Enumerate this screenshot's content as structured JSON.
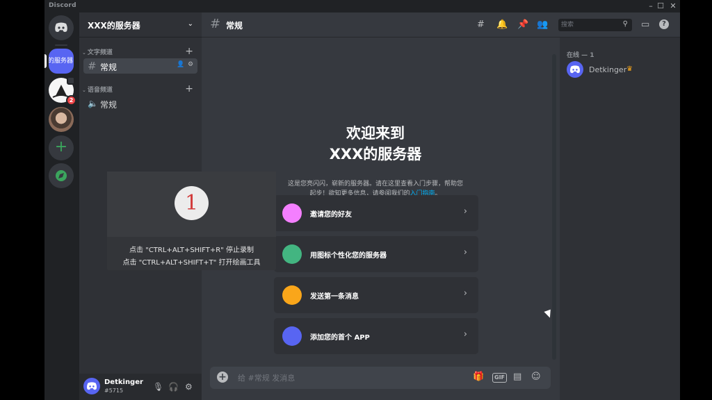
{
  "window": {
    "app_name": "Discord",
    "controls": {
      "minimize": "–",
      "maximize": "☐",
      "close": "✕"
    }
  },
  "rail": {
    "active_server_label": "的服务器",
    "server2_badge": "2"
  },
  "server": {
    "name": "XXX的服务器"
  },
  "categories": [
    {
      "label": "文字频道"
    },
    {
      "label": "语音频道"
    }
  ],
  "channels": {
    "text": [
      {
        "label": "常规"
      }
    ],
    "voice": [
      {
        "label": "常规"
      }
    ]
  },
  "user": {
    "name": "Detkinger",
    "tag": "#5715"
  },
  "topbar": {
    "channel": "常规",
    "search_placeholder": "搜索"
  },
  "welcome": {
    "title_line1": "欢迎来到",
    "title_line2": "XXX的服务器",
    "desc_line1": "这是您亮闪闪，崭新的服务器。请在这里查看入门步骤，帮助您",
    "desc_line2_prefix": "起步！欲知更多信息，请参阅我们的",
    "desc_link": "入门指南",
    "desc_end": "。"
  },
  "cards": [
    {
      "label": "邀请您的好友",
      "icon": "invite-icon",
      "color": "#f47fff"
    },
    {
      "label": "用图标个性化您的服务器",
      "icon": "personalize-icon",
      "color": "#43b581"
    },
    {
      "label": "发送第一条消息",
      "icon": "message-icon",
      "color": "#faa61a"
    },
    {
      "label": "添加您的首个 APP",
      "icon": "app-icon",
      "color": "#5865f2"
    }
  ],
  "composer": {
    "placeholder": "给 #常规 发消息",
    "gif_label": "GIF"
  },
  "members": {
    "heading": "在线 — 1",
    "list": [
      {
        "name": "Detkinger",
        "crown": "♛"
      }
    ]
  },
  "overlay": {
    "number": "1",
    "hint1": "点击 \"CTRL+ALT+SHIFT+R\" 停止录制",
    "hint2": "点击 \"CTRL+ALT+SHIFT+T\" 打开绘画工具"
  },
  "colors": {
    "accent": "#5865f2",
    "link": "#00aff4",
    "online_green": "#3ba55d",
    "badge_red": "#ed4245"
  }
}
